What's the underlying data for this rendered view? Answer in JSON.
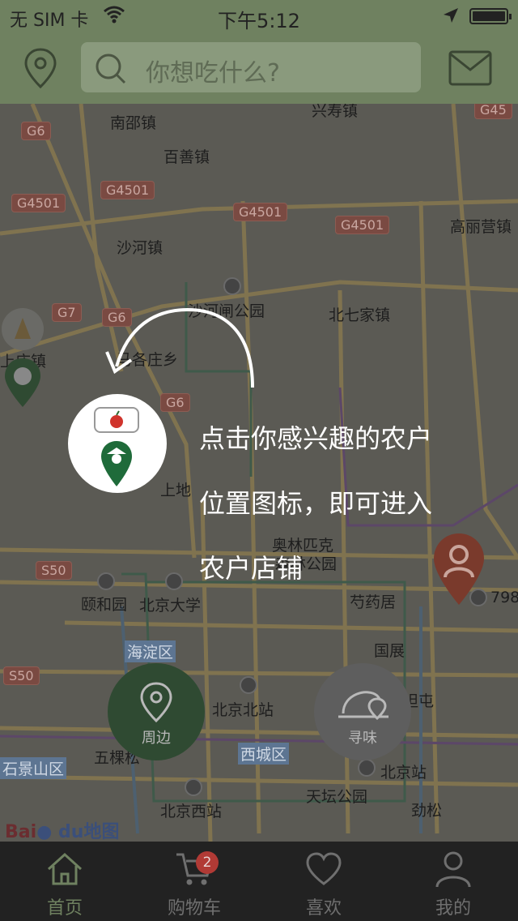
{
  "status_bar": {
    "carrier": "无 SIM 卡",
    "time": "下午5:12"
  },
  "header": {
    "search_placeholder": "你想吃什么?"
  },
  "map": {
    "places": [
      "南邵镇",
      "百善镇",
      "沙河镇",
      "沙河闸公园",
      "北七家镇",
      "高丽营镇",
      "上地",
      "奥林匹克",
      "森林公园",
      "颐和园",
      "北京大学",
      "芍药居",
      "海淀区",
      "国展",
      "北京北站",
      "五棵松",
      "西城区",
      "北京站",
      "石景山区",
      "天坛公园",
      "北京西站",
      "劲松",
      "兴寿镇",
      "上庄镇",
      "马各庄乡",
      "798",
      "坦屯"
    ],
    "highways": [
      "G6",
      "G4501",
      "G7",
      "S50",
      "G45"
    ],
    "logo": {
      "bai": "Bai",
      "du": "du",
      "tail": "地图"
    }
  },
  "hint": {
    "lines": [
      "点击你感兴趣的农户",
      "位置图标，即可进入",
      "农户店铺"
    ]
  },
  "actions": {
    "nearby": "周边",
    "taste": "寻味"
  },
  "tabs": [
    {
      "label": "首页",
      "icon": "home-icon",
      "active": true
    },
    {
      "label": "购物车",
      "icon": "cart-icon",
      "badge": "2"
    },
    {
      "label": "喜欢",
      "icon": "heart-icon"
    },
    {
      "label": "我的",
      "icon": "user-icon"
    }
  ],
  "colors": {
    "header": "#6f8160",
    "accent_green": "#2f4a32",
    "badge_red": "#b13a35",
    "tabbar": "#222222"
  }
}
